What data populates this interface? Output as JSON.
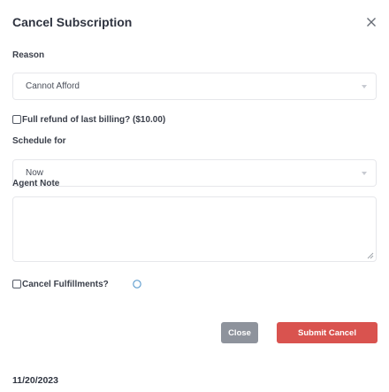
{
  "dialog": {
    "title": "Cancel Subscription",
    "close_icon": "close-icon"
  },
  "form": {
    "reason_label": "Reason",
    "reason_value": "Cannot Afford",
    "refund_checkbox_label": "Full refund of last billing? ($10.00)",
    "refund_checked": false,
    "schedule_label": "Schedule for",
    "schedule_value": "Now",
    "agent_note_label": "Agent Note",
    "agent_note_value": "",
    "fulfillments_checkbox_label": "Cancel Fulfillments?",
    "fulfillments_checked": false,
    "info_icon": "info-circle-icon"
  },
  "actions": {
    "close_label": "Close",
    "submit_label": "Submit Cancel"
  },
  "footer": {
    "date": "11/20/2023"
  },
  "colors": {
    "submit": "#d9534f",
    "close": "#8e939c",
    "border": "#e6e7eb",
    "info": "#4a90c8"
  }
}
